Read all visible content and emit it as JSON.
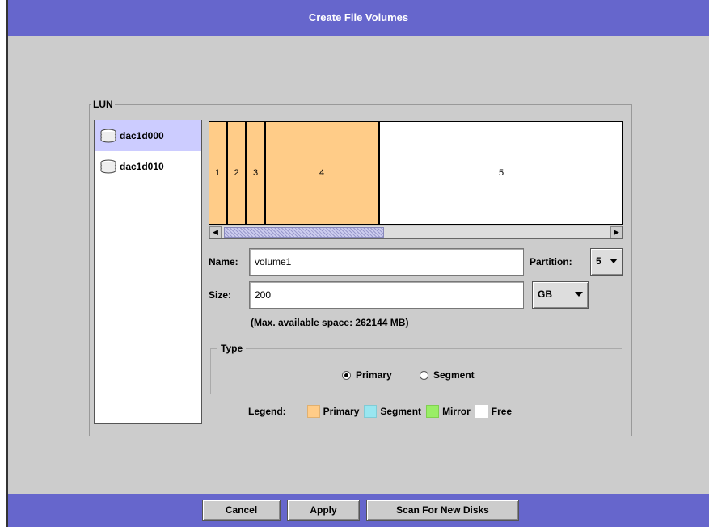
{
  "window": {
    "title": "Create File Volumes"
  },
  "lun": {
    "group_label": "LUN",
    "items": [
      {
        "label": "dac1d000",
        "icon": "disk-stack-icon",
        "selected": true
      },
      {
        "label": "dac1d010",
        "icon": "disk-stack-icon",
        "selected": false
      }
    ]
  },
  "partition_map": {
    "segments": [
      {
        "label": "1",
        "color": "#ffcc88"
      },
      {
        "label": "2",
        "color": "#ffcc88"
      },
      {
        "label": "3",
        "color": "#ffcc88"
      },
      {
        "label": "4",
        "color": "#ffcc88"
      },
      {
        "label": "5",
        "color": "#ffffff"
      }
    ]
  },
  "form": {
    "name_label": "Name:",
    "name_value": "volume1",
    "partition_label": "Partition:",
    "partition_value": "5",
    "size_label": "Size:",
    "size_value": "200",
    "size_unit": "GB",
    "max_space": "(Max. available space: 262144 MB)"
  },
  "type": {
    "group_label": "Type",
    "options": [
      {
        "label": "Primary",
        "checked": true
      },
      {
        "label": "Segment",
        "checked": false
      }
    ]
  },
  "legend": {
    "label": "Legend:",
    "items": [
      {
        "label": "Primary",
        "color": "#ffcc88"
      },
      {
        "label": "Segment",
        "color": "#99e6f0"
      },
      {
        "label": "Mirror",
        "color": "#99ee66"
      },
      {
        "label": "Free",
        "color": "#ffffff"
      }
    ]
  },
  "buttons": {
    "cancel": "Cancel",
    "apply": "Apply",
    "scan": "Scan For New Disks"
  },
  "colors": {
    "titlebar": "#6666cc",
    "panel": "#cccccc",
    "selection": "#ccccff"
  }
}
